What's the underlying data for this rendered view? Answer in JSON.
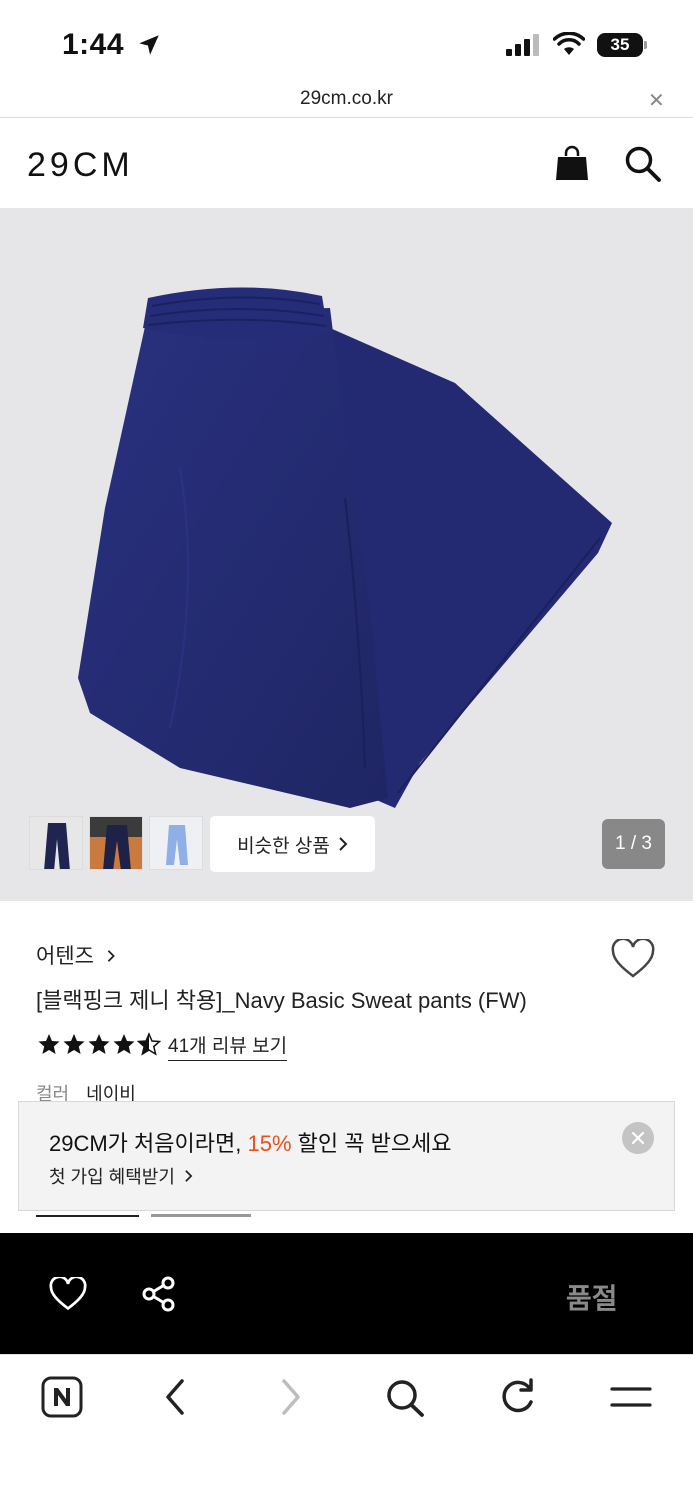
{
  "status_bar": {
    "time": "1:44",
    "battery": "35"
  },
  "url_bar": {
    "url": "29cm.co.kr",
    "close": "✕"
  },
  "header": {
    "logo": "29CM"
  },
  "gallery": {
    "similar_label": "비슷한 상품",
    "pager": "1 / 3",
    "colors": {
      "background": "#e6e6e9",
      "product": "#232a6e"
    }
  },
  "product": {
    "brand": "어텐즈",
    "title": "[블랙핑크 제니 착용]_Navy Basic Sweat pants (FW)",
    "rating": 4.5,
    "review_link": "41개 리뷰 보기",
    "color_label": "컬러",
    "color_value": "네이비"
  },
  "promo": {
    "headline_prefix": "29CM가 처음이라면, ",
    "headline_pct": "15%",
    "headline_suffix": " 할인 꼭 받으세요",
    "sub": "첫 가입 혜택받기",
    "accent": "#e8501e"
  },
  "action_bar": {
    "soldout": "품절"
  }
}
